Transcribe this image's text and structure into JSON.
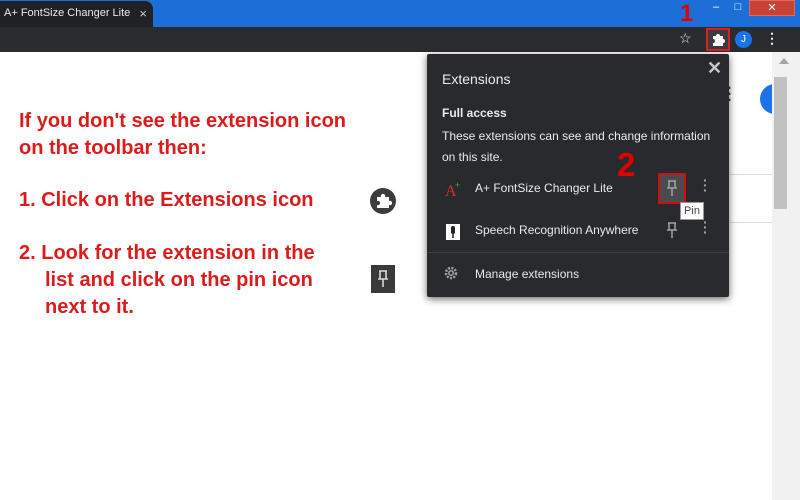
{
  "browser": {
    "tab_title": "A+ FontSize Changer Lite - Chrome",
    "tab_close": "×",
    "window_min": "–",
    "window_max": "□",
    "window_close": "✕",
    "avatar_initial": "J"
  },
  "callouts": {
    "one": "1",
    "two": "2"
  },
  "instructions": {
    "line1": "If you don't see the extension icon",
    "line2": "on the toolbar then:",
    "step1": "1. Click on the Extensions icon",
    "step2_a": "2. Look for the extension in the",
    "step2_b": "list and click on the pin icon",
    "step2_c": "next to it."
  },
  "extensions_popup": {
    "title": "Extensions",
    "close": "✕",
    "full_access": "Full access",
    "access_description": "These extensions can see and change information on this site.",
    "items": [
      {
        "name": "A+ FontSize Changer Lite",
        "icon": "font-size-icon",
        "pinned_highlight": true
      },
      {
        "name": "Speech Recognition Anywhere",
        "icon": "microphone-icon",
        "pinned_highlight": false
      }
    ],
    "pin_tooltip": "Pin",
    "manage": "Manage extensions"
  },
  "colors": {
    "accent_red": "#e00000",
    "instruction_red": "#dd1b1b",
    "popup_bg": "#292a2d",
    "titlebar_blue": "#1c6fd6"
  }
}
